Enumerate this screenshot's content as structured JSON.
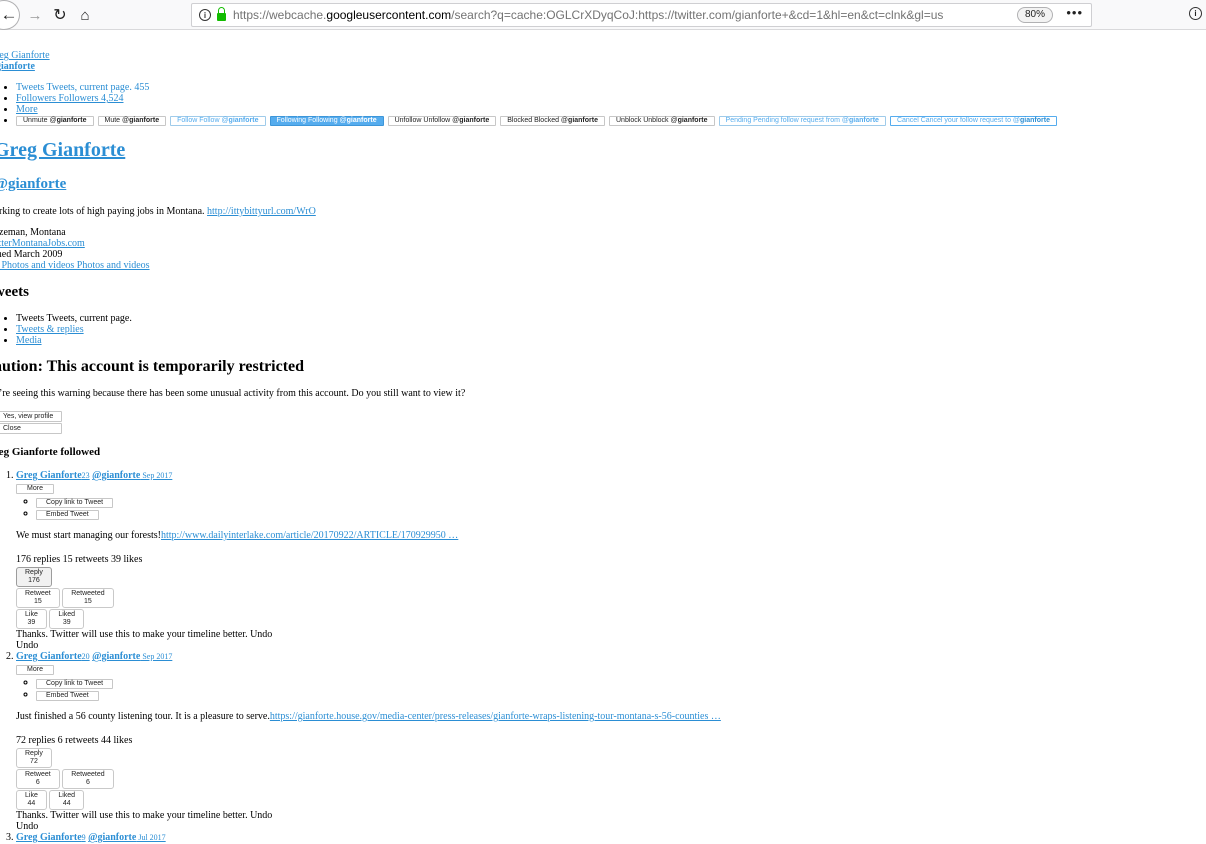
{
  "browser": {
    "url_prefix": "https://webcache.",
    "url_host": "googleusercontent.com",
    "url_rest": "/search?q=cache:OGLCrXDyqCoJ:https://twitter.com/gianforte+&cd=1&hl=en&ct=clnk&gl=us",
    "zoom": "80%",
    "menu": "•••"
  },
  "header": {
    "name_link": "reg Gianforte",
    "handle_link": "gianforte"
  },
  "stats": {
    "tweets": "Tweets Tweets, current page. 455",
    "followers": "Followers Followers 4,524",
    "more": " More"
  },
  "user_buttons": [
    {
      "pre": "Unmute @",
      "b": "gianforte",
      "style": ""
    },
    {
      "pre": "Mute @",
      "b": "gianforte",
      "style": ""
    },
    {
      "pre": "Follow Follow @",
      "b": "gianforte",
      "style": "blue-text"
    },
    {
      "pre": "Following Following @",
      "b": "gianforte",
      "style": "filled"
    },
    {
      "pre": "Unfollow Unfollow @",
      "b": "gianforte",
      "style": ""
    },
    {
      "pre": "Blocked Blocked @",
      "b": "gianforte",
      "style": ""
    },
    {
      "pre": "Unblock Unblock @",
      "b": "gianforte",
      "style": ""
    },
    {
      "pre": "Pending Pending follow request from @",
      "b": "gianforte",
      "style": "blue-text"
    },
    {
      "pre": "Cancel Cancel your follow request to @",
      "b": "gianforte",
      "style": "outline-blue"
    }
  ],
  "profile": {
    "name": "Greg Gianforte",
    "handle": "@gianforte",
    "bio": "orking to create lots of high paying jobs in Montana. ",
    "bio_link": "http://ittybittyurl.com/WrO",
    "location": "ozeman, Montana",
    "website": "etterMontanaJobs.com",
    "joined": "ined March 2009",
    "photos": "8 Photos and videos Photos and videos"
  },
  "tweets_heading": "weets",
  "tabs": {
    "tweets": "Tweets Tweets, current page.",
    "replies": "Tweets & replies",
    "media": "Media"
  },
  "caution": {
    "title": "aution: This account is temporarily restricted",
    "text": "u’re seeing this warning because there has been some unusual activity from this account. Do you still want to view it?",
    "view_btn": "Yes, view profile",
    "close_btn": "Close"
  },
  "followed_heading": "reg Gianforte followed",
  "tweets": [
    {
      "author": " Greg Gianforte",
      "count": "23",
      "handle": "@gianforte",
      "date": " Sep 2017",
      "more": "More",
      "copy": "Copy link to Tweet",
      "embed": "Embed Tweet",
      "text": "We must start managing our forests!",
      "link": "http://www.dailyinterlake.com/article/20170922/ARTICLE/170929950 …",
      "counts": "176 replies 15 retweets 39 likes",
      "reply": "Reply",
      "reply_n": "176",
      "retweet": "Retweet",
      "retweet_n": "15",
      "retweeted": "Retweeted",
      "retweeted_n": "15",
      "like": "Like",
      "like_n": "39",
      "liked": "Liked",
      "liked_n": "39",
      "thanks": "Thanks. Twitter will use this to make your timeline better. Undo",
      "undo": "Undo"
    },
    {
      "author": " Greg Gianforte",
      "count": "20",
      "handle": "@gianforte",
      "date": " Sep 2017",
      "more": "More",
      "copy": "Copy link to Tweet",
      "embed": "Embed Tweet",
      "text": "Just finished a 56 county listening tour. It is a pleasure to serve.",
      "link": "https://gianforte.house.gov/media-center/press-releases/gianforte-wraps-listening-tour-montana-s-56-counties …",
      "counts": "72 replies 6 retweets 44 likes",
      "reply": "Reply",
      "reply_n": "72",
      "retweet": "Retweet",
      "retweet_n": "6",
      "retweeted": "Retweeted",
      "retweeted_n": "6",
      "like": "Like",
      "like_n": "44",
      "liked": "Liked",
      "liked_n": "44",
      "thanks": "Thanks. Twitter will use this to make your timeline better. Undo",
      "undo": "Undo"
    },
    {
      "author": " Greg Gianforte",
      "count": "9",
      "handle": "@gianforte",
      "date": " Jul 2017"
    }
  ]
}
